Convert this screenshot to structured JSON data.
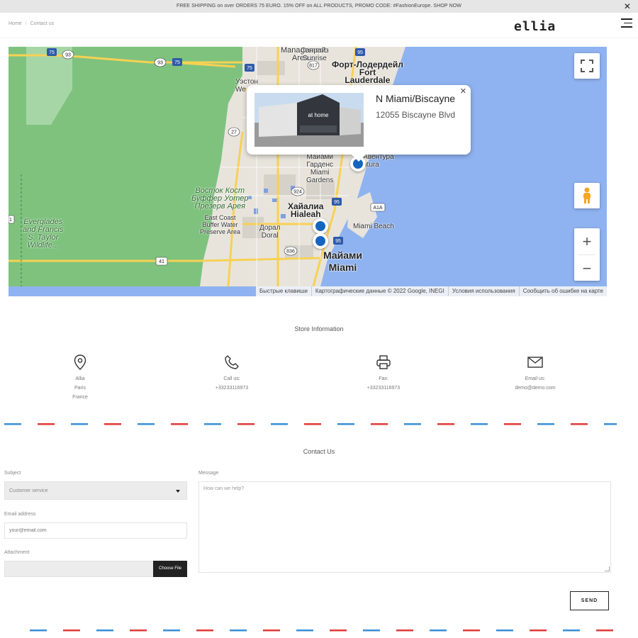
{
  "topbar": {
    "promo_text": "FREE SHIPPING on over ORDERS 75 EURO. 15% OFF on ALL PRODUCTS, PROMO CODE: #FashionEurope. SHOP NOW",
    "close_glyph": "✕"
  },
  "header": {
    "breadcrumb": [
      "Home",
      "Contact us"
    ],
    "breadcrumb_sep": "/",
    "logo": "ellia"
  },
  "map": {
    "labels": {
      "sunrise": "Санрайз\nSunrise",
      "fort_lauderdale": "Форт-Лодердейл\nFort\nLauderdale",
      "weston": "Уэстон\nWe",
      "miami_gardens": "Майами\nГарденс\nMiami\nGardens",
      "aventura": "Авентура\nntura",
      "east_coast": "Восток Кост\nБуффер Уотер\nПрезерв Арея",
      "east_coast_en": "East Coast\nBuffer Water\nPreserve Area",
      "hialeah": "Хайалиа\nHialeah",
      "miami_beach": "Miami Beach",
      "doral": "Дорал\nDoral",
      "miami": "Майами\nMiami",
      "everglades": "Everglades\nand Francis\nS. Taylor\nWildlife...",
      "management": "Management\nArea..."
    },
    "road_numbers": [
      "75",
      "93",
      "93",
      "75",
      "75",
      "817",
      "95",
      "27",
      "924",
      "95",
      "A1A",
      "95",
      "836",
      "41",
      "1"
    ],
    "infowindow": {
      "title": "N Miami/Biscayne",
      "address": "12055 Biscayne Blvd",
      "photo_sign": "at home",
      "close_glyph": "✕"
    },
    "zoom_in": "+",
    "zoom_out": "−",
    "attribution": [
      "Быстрые клавиши",
      "Картографические данные © 2022 Google, INEGI",
      "Условия использования",
      "Сообщить об ошибке на карте"
    ]
  },
  "store_info": {
    "title": "Store Information",
    "address": {
      "line1": "Allia",
      "line2": "Paris",
      "line3": "France"
    },
    "phone": {
      "label": "Call us:",
      "value": "+33233116973"
    },
    "fax": {
      "label": "Fax:",
      "value": "+33233116973"
    },
    "email": {
      "label": "Email us:",
      "value": "demo@demo.com"
    }
  },
  "contact": {
    "title": "Contact Us",
    "subject_label": "Subject",
    "subject_value": "Customer service",
    "email_label": "Email address",
    "email_placeholder": "your@email.com",
    "attachment_label": "Attachment",
    "choose_file": "Choose File",
    "message_label": "Message",
    "message_placeholder": "How can we help?",
    "send": "SEND"
  },
  "colors": {
    "water": "#8fb3f0",
    "land_green": "#7ec27e",
    "urban": "#e8e4dc",
    "road_yellow": "#f7d154",
    "pin_blue": "#1565c0",
    "dash_red": "#e03a3a",
    "dash_blue": "#3a8fd6"
  }
}
